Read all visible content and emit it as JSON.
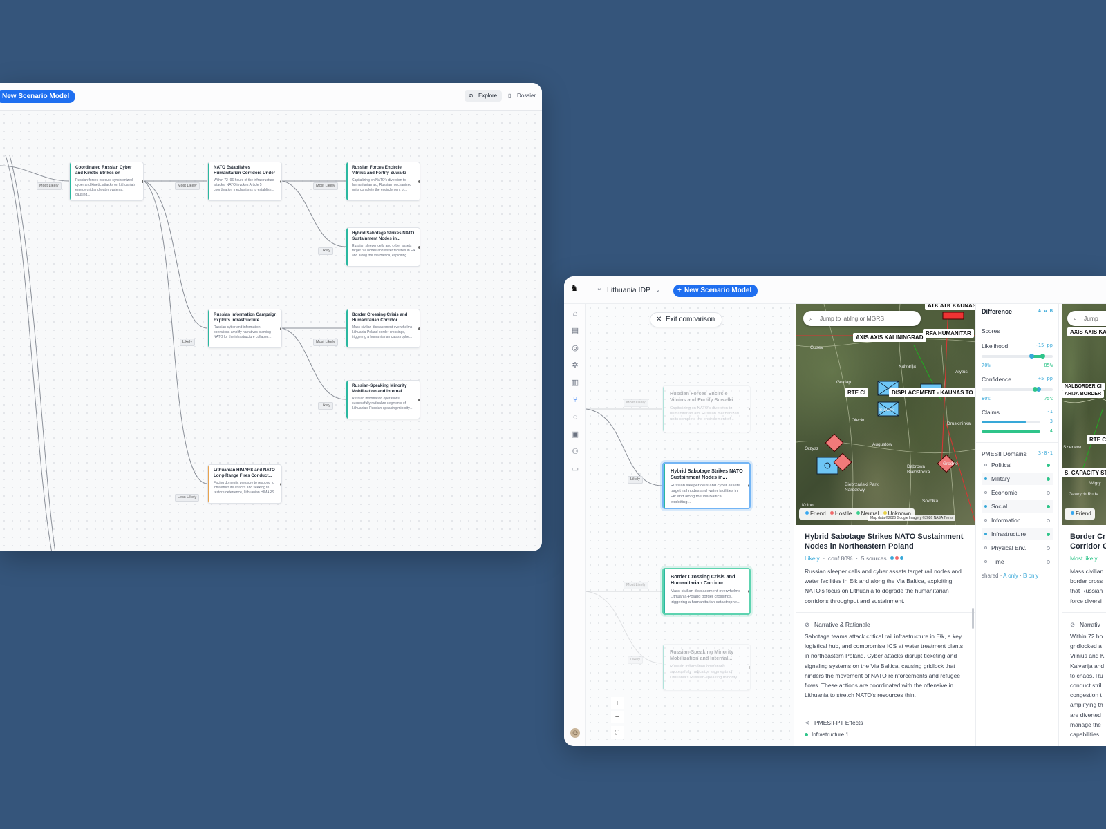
{
  "win1": {
    "new_model_label": "New Scenario Model",
    "tabs": {
      "explore": "Explore",
      "dossier": "Dossier"
    },
    "nodes": [
      {
        "title": "Coordinated Russian Cyber and Kinetic Strikes on Critical...",
        "desc": "Russian forces execute synchronized cyber and kinetic attacks on Lithuania's energy grid and water systems, causing..."
      },
      {
        "title": "NATO Establishes Humanitarian Corridors Under Article 5...",
        "desc": "Within 72–96 hours of the infrastructure attacks, NATO invokes Article 5 coordination mechanisms to establish..."
      },
      {
        "title": "Russian Forces Encircle Vilnius and Fortify Suwałki Corridor",
        "desc": "Capitalizing on NATO's diversion to humanitarian aid, Russian mechanized units complete the encirclement of..."
      },
      {
        "title": "Hybrid Sabotage Strikes NATO Sustainment Nodes in...",
        "desc": "Russian sleeper cells and cyber assets target rail nodes and water facilities in Ełk and along the Via Baltica, exploiting..."
      },
      {
        "title": "Russian Information Campaign Exploits Infrastructure Collapse",
        "desc": "Russian cyber and information operations amplify narratives blaming NATO for the infrastructure collapse..."
      },
      {
        "title": "Border Crossing Crisis and Humanitarian Corridor Collapse",
        "desc": "Mass civilian displacement overwhelms Lithuania-Poland border crossings, triggering a humanitarian catastrophe..."
      },
      {
        "title": "Russian-Speaking Minority Mobilization and Internal...",
        "desc": "Russian information operations successfully radicalize segments of Lithuania's Russian-speaking minority..."
      },
      {
        "title": "Lithuanian HIMARS and NATO Long-Range Fires Conduct...",
        "desc": "Facing domestic pressure to respond to infrastructure attacks and seeking to restore deterrence, Lithuanian HIMARS..."
      }
    ],
    "edge_labels": [
      "Most Likely",
      "Most Likely",
      "Most Likely",
      "Likely",
      "Likely",
      "Most Likely",
      "Likely",
      "Less Likely"
    ]
  },
  "win2": {
    "project_name": "Lithuania IDP",
    "new_model_label": "New Scenario Model",
    "exit_label": "Exit comparison",
    "zoom": {
      "plus": "+",
      "minus": "−",
      "fit": "⛶"
    },
    "nodes": [
      {
        "title": "Russian Forces Encircle Vilnius and Fortify Suwałki Corridor",
        "desc": "Capitalizing on NATO's diversion to humanitarian aid, Russian mechanized units complete the encirclement of..."
      },
      {
        "title": "Hybrid Sabotage Strikes NATO Sustainment Nodes in...",
        "desc": "Russian sleeper cells and cyber assets target rail nodes and water facilities in Ełk and along the Via Baltica, exploiting..."
      },
      {
        "title": "Border Crossing Crisis and Humanitarian Corridor Collapse",
        "desc": "Mass civilian displacement overwhelms Lithuania-Poland border crossings, triggering a humanitarian catastrophe..."
      },
      {
        "title": "Russian-Speaking Minority Mobilization and Internal...",
        "desc": "Russian information operations successfully radicalize segments of Lithuania's Russian-speaking minority..."
      }
    ],
    "edge_labels": [
      "Most Likely",
      "Likely",
      "Most Likely",
      "Likely"
    ],
    "map": {
      "search_placeholder": "Jump to lat/lng or MGRS",
      "labels": [
        "AXIS AXIS KALININGRAD",
        "RTE CI",
        "DISPLACEMENT - KAUNAS TO LA",
        "RFA HUMANITAR",
        "ATK ATK KAUNAS"
      ],
      "legend": [
        {
          "label": "Friend",
          "color": "#38a8f0"
        },
        {
          "label": "Hostile",
          "color": "#f06a6a"
        },
        {
          "label": "Neutral",
          "color": "#3ccf8e"
        },
        {
          "label": "Unknown",
          "color": "#e8d24a"
        }
      ],
      "attribution": "Map data ©2026 Google Imagery ©2026 NASA",
      "terms": "Terms",
      "places": [
        "Kalvarija",
        "Goldap",
        "Augustów",
        "Suwałki",
        "Biebrzański Park Narodowy",
        "Dąbrowa Białostocka",
        "Sokółka",
        "Druskininkai",
        "Alytus",
        "Gusev",
        "Olecko",
        "Orzysz",
        "Grodno",
        "Kolno"
      ]
    },
    "detail": {
      "title": "Hybrid Sabotage Strikes NATO Sustainment Nodes in Northeastern Poland",
      "likelihood": "Likely",
      "conf": "conf 80%",
      "sources": "5 sources",
      "summary": "Russian sleeper cells and cyber assets target rail nodes and water facilities in Ełk and along the Via Baltica, exploiting NATO's focus on Lithuania to degrade the humanitarian corridor's throughput and sustainment.",
      "narrative_heading": "Narrative & Rationale",
      "narrative": "Sabotage teams attack critical rail infrastructure in Ełk, a key logistical hub, and compromise ICS at water treatment plants in northeastern Poland. Cyber attacks disrupt ticketing and signaling systems on the Via Baltica, causing gridlock that hinders the movement of NATO reinforcements and refugee flows. These actions are coordinated with the offensive in Lithuania to stretch NATO's resources thin.",
      "effects_heading": "PMESII-PT Effects",
      "effects_first": "Infrastructure",
      "effects_count": "1"
    },
    "difference": {
      "heading": "Difference",
      "ab": "A ↔ B",
      "scores": "Scores",
      "likelihood_label": "Likelihood",
      "likelihood_delta": "-15 pp",
      "likelihood_a": "70%",
      "likelihood_b": "85%",
      "likelihood_a_val": 0.7,
      "likelihood_b_val": 0.85,
      "confidence_label": "Confidence",
      "confidence_delta": "+5 pp",
      "confidence_a": "80%",
      "confidence_b": "75%",
      "confidence_a_val": 0.8,
      "confidence_b_val": 0.75,
      "claims_label": "Claims",
      "claims_delta": "-1",
      "claims_a": "3",
      "claims_b": "4",
      "claims_a_val": 0.75,
      "claims_b_val": 1.0,
      "domains_heading": "PMESII Domains",
      "domains_count": "3·0·1",
      "domains": [
        {
          "label": "Political",
          "a": false,
          "b": true
        },
        {
          "label": "Military",
          "a": true,
          "b": true
        },
        {
          "label": "Economic",
          "a": false,
          "b": false
        },
        {
          "label": "Social",
          "a": true,
          "b": true
        },
        {
          "label": "Information",
          "a": false,
          "b": false
        },
        {
          "label": "Infrastructure",
          "a": true,
          "b": true
        },
        {
          "label": "Physical Env.",
          "a": false,
          "b": false
        },
        {
          "label": "Time",
          "a": false,
          "b": false
        }
      ],
      "shared": "shared",
      "a_only": "A only",
      "b_only": "B only"
    },
    "peek": {
      "search_placeholder": "Jump",
      "labels": [
        "AXIS AXIS KA",
        "NALBORDER CI",
        "ARIJA BORDER",
        "RTE C",
        "S, CAPACITY ST"
      ],
      "places": [
        "Wigry",
        "Gawrych Ruda",
        "Szlenewo"
      ],
      "legend_friend": "Friend",
      "title": "Border Crossing Crisis and Humanitarian Corridor Collapse",
      "title_l1": "Border Cr",
      "title_l2": "Corridor C",
      "likelihood": "Most likely",
      "summary_lines": [
        "Mass civilian",
        "border cross",
        "that Russian",
        "force diversi"
      ],
      "narrative_heading": "Narrativ",
      "narrative_lines": [
        "Within 72 ho",
        "gridlocked a",
        "Vilnius and K",
        "Kalvarija and",
        "to chaos. Ru",
        "conduct stril",
        "congestion t",
        "amplifying th",
        "are diverted",
        "manage the",
        "capabilities."
      ]
    }
  }
}
